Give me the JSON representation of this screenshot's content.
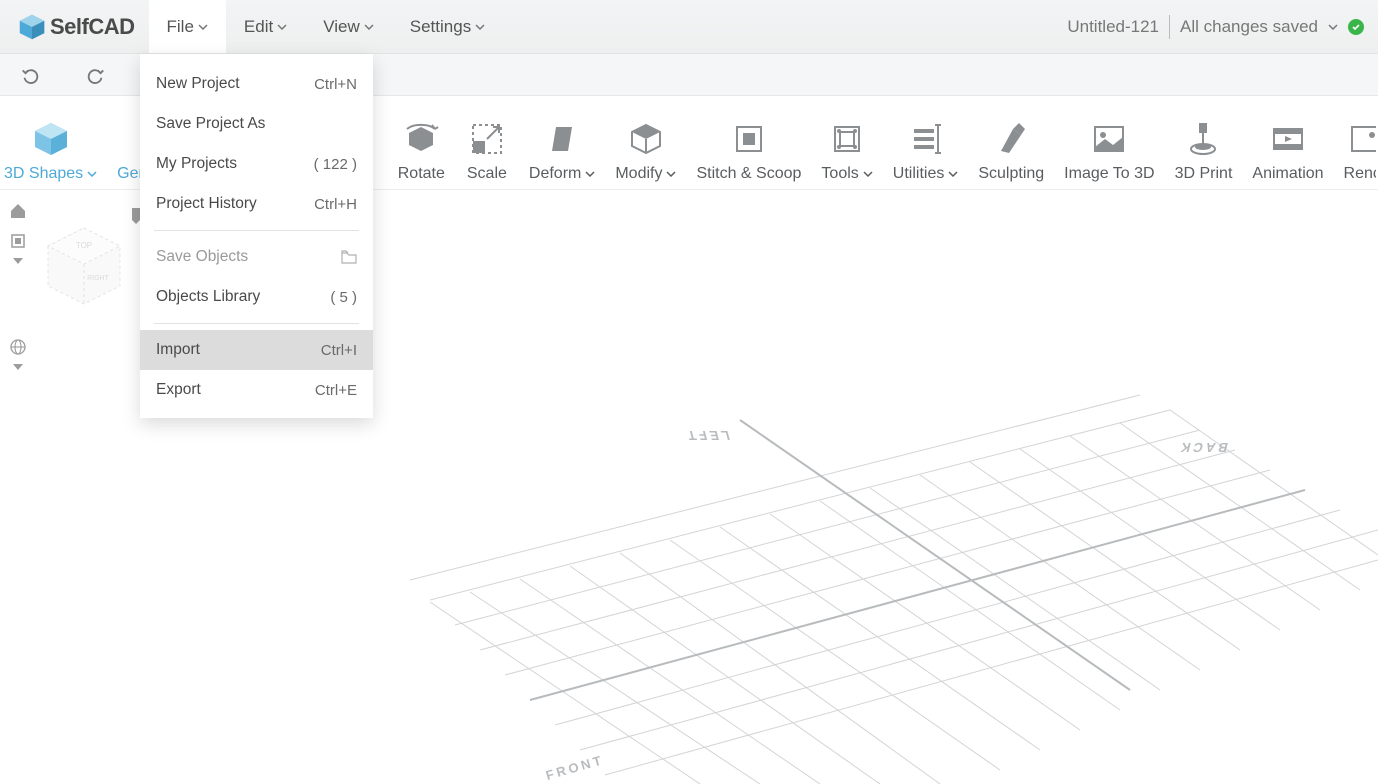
{
  "app": {
    "logo_text": "SelfCAD",
    "project_title": "Untitled-121",
    "save_status": "All changes saved"
  },
  "menubar": {
    "items": [
      "File",
      "Edit",
      "View",
      "Settings"
    ],
    "active_index": 0
  },
  "file_menu": {
    "items": [
      {
        "label": "New Project",
        "shortcut": "Ctrl+N",
        "disabled": false
      },
      {
        "label": "Save Project As",
        "shortcut": "",
        "disabled": false
      },
      {
        "label": "My Projects",
        "shortcut": "( 122 )",
        "disabled": false
      },
      {
        "label": "Project History",
        "shortcut": "Ctrl+H",
        "disabled": false
      },
      {
        "sep": true
      },
      {
        "label": "Save Objects",
        "shortcut": "",
        "disabled": true,
        "icon": "folder"
      },
      {
        "label": "Objects Library",
        "shortcut": "( 5 )",
        "disabled": false
      },
      {
        "sep": true
      },
      {
        "label": "Import",
        "shortcut": "Ctrl+I",
        "disabled": false,
        "hover": true
      },
      {
        "label": "Export",
        "shortcut": "Ctrl+E",
        "disabled": false
      }
    ]
  },
  "toolbar": {
    "items": [
      {
        "label": "3D Shapes",
        "dropdown": true,
        "accent": true,
        "icon": "cube"
      },
      {
        "label": "Generators",
        "dropdown": true,
        "accent": true,
        "icon": "gen",
        "clipped": true
      },
      {
        "label": "Rotate",
        "dropdown": false,
        "icon": "rotate"
      },
      {
        "label": "Scale",
        "dropdown": false,
        "icon": "scale"
      },
      {
        "label": "Deform",
        "dropdown": true,
        "icon": "deform"
      },
      {
        "label": "Modify",
        "dropdown": true,
        "icon": "modify"
      },
      {
        "label": "Stitch & Scoop",
        "dropdown": false,
        "icon": "stitch"
      },
      {
        "label": "Tools",
        "dropdown": true,
        "icon": "tools"
      },
      {
        "label": "Utilities",
        "dropdown": true,
        "icon": "utilities"
      },
      {
        "label": "Sculpting",
        "dropdown": false,
        "icon": "sculpt"
      },
      {
        "label": "Image To 3D",
        "dropdown": false,
        "icon": "image3d"
      },
      {
        "label": "3D Print",
        "dropdown": false,
        "icon": "print3d"
      },
      {
        "label": "Animation",
        "dropdown": false,
        "icon": "animation"
      },
      {
        "label": "Render",
        "dropdown": false,
        "icon": "render",
        "clipped_right": true
      }
    ]
  },
  "viewport": {
    "labels": {
      "left": "LEFT",
      "back": "BACK",
      "front": "FRONT"
    }
  }
}
